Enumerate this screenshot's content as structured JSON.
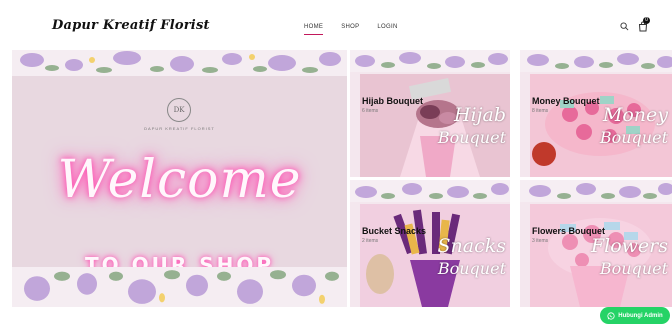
{
  "header": {
    "logo": "Dapur Kreatif Florist",
    "nav": [
      "HOME",
      "SHOP",
      "LOGIN"
    ],
    "cart_count": "0"
  },
  "hero": {
    "brand_mark": "DK",
    "brand_mark_text": "DAPUR KREATIF FLORIST",
    "welcome": "Welcome",
    "to_shop": "TO OUR SHOP"
  },
  "categories": [
    {
      "title": "Hijab Bouquet",
      "count": "6 items",
      "script_line1": "Hijab",
      "script_line2": "Bouquet"
    },
    {
      "title": "Money Bouquet",
      "count": "8 items",
      "script_line1": "Money",
      "script_line2": "Bouquet"
    },
    {
      "title": "Bucket Snacks",
      "count": "2 items",
      "script_line1": "Snacks",
      "script_line2": "Bouquet"
    },
    {
      "title": "Flowers Bouquet",
      "count": "3 items",
      "script_line1": "Flowers",
      "script_line2": "Bouquet"
    }
  ],
  "whatsapp": {
    "label": "Hubungi Admin"
  },
  "colors": {
    "accent": "#c2185b",
    "whatsapp": "#25d366",
    "hero_bg": "#e8d8e0"
  }
}
